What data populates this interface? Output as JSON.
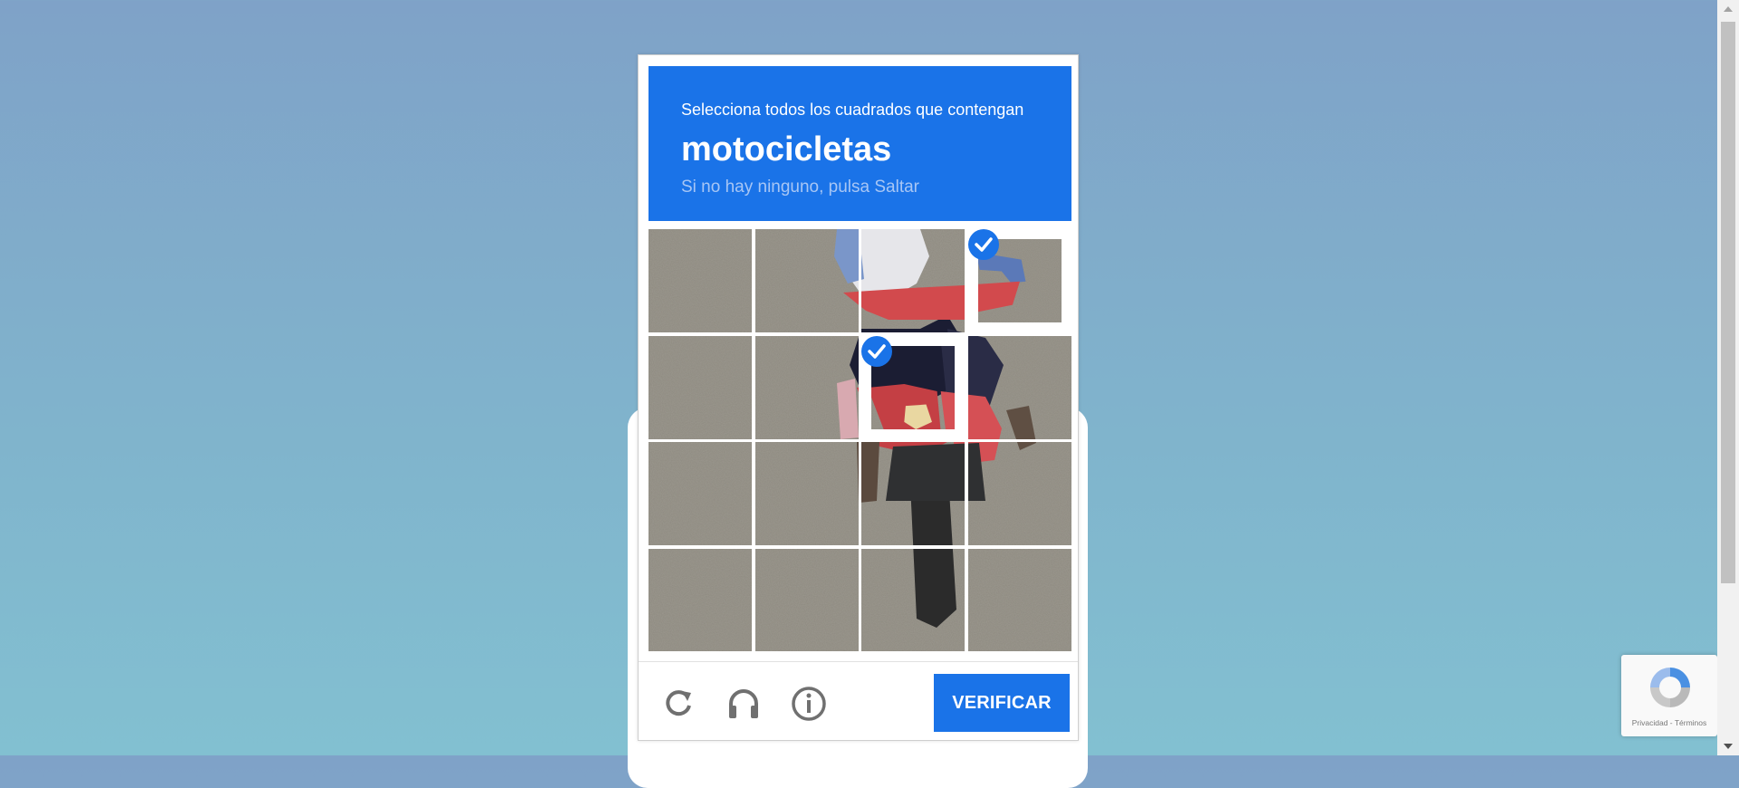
{
  "challenge": {
    "instruction": "Selecciona todos los cuadrados que contengan",
    "object": "motocicletas",
    "hint": "Si no hay ninguno, pulsa Saltar"
  },
  "grid": {
    "rows": 4,
    "cols": 4,
    "selected_tiles": [
      [
        0,
        3
      ],
      [
        1,
        2
      ]
    ]
  },
  "footer": {
    "reload_icon": "reload-icon",
    "audio_icon": "headphones-icon",
    "info_icon": "info-icon",
    "verify_label": "VERIFICAR"
  },
  "badge": {
    "privacy": "Privacidad",
    "separator": " - ",
    "terms": "Términos"
  },
  "colors": {
    "accent": "#1a73e8",
    "hint": "#a7c6f5",
    "background_top": "#7fa2c8",
    "background_bottom": "#82c0d1"
  }
}
